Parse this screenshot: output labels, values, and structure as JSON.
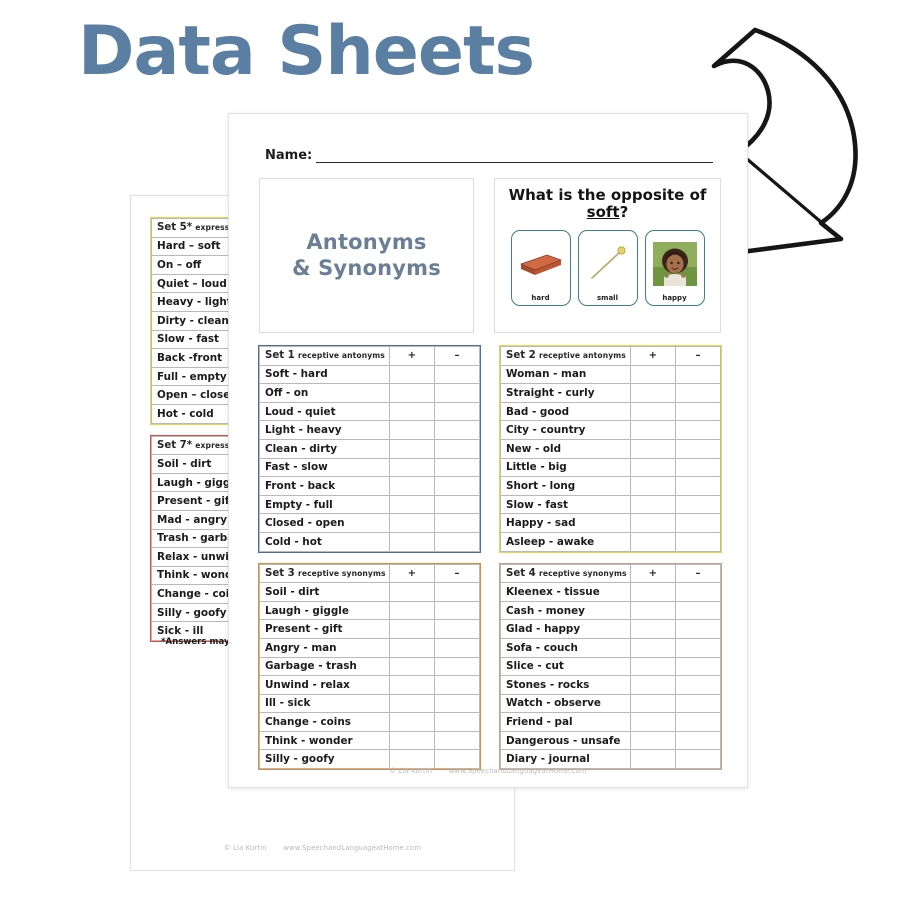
{
  "page": {
    "title": "Data Sheets",
    "title_color": "#5b7fa3",
    "arrow_icon": "curved-down-left-arrow"
  },
  "front_sheet": {
    "name_label": "Name:",
    "title_box": {
      "line1": "Antonyms",
      "line2": "& Synonyms"
    },
    "question_box": {
      "prompt_prefix": "What is the opposite of",
      "prompt_word": "soft",
      "prompt_suffix": "?",
      "cards": [
        {
          "label": "hard",
          "icon": "brick-image"
        },
        {
          "label": "small",
          "icon": "pin-needle-image"
        },
        {
          "label": "happy",
          "icon": "smiling-girl-photo"
        }
      ]
    },
    "mark_columns": {
      "plus": "+",
      "minus": "–"
    },
    "tables": [
      {
        "set_name": "Set 1",
        "set_sub": "receptive antonyms",
        "accent": "#4a6fa5",
        "accent_class": "blue",
        "rows": [
          "Soft - hard",
          "Off - on",
          "Loud - quiet",
          "Light - heavy",
          "Clean - dirty",
          "Fast - slow",
          "Front - back",
          "Empty - full",
          "Closed - open",
          "Cold - hot"
        ]
      },
      {
        "set_name": "Set 2",
        "set_sub": "receptive antonyms",
        "accent": "#efd64b",
        "accent_class": "yellow",
        "rows": [
          "Woman - man",
          "Straight - curly",
          "Bad - good",
          "City - country",
          "New - old",
          "Little - big",
          "Short - long",
          "Slow - fast",
          "Happy - sad",
          "Asleep - awake"
        ]
      },
      {
        "set_name": "Set 3",
        "set_sub": "receptive synonyms",
        "accent": "#e08a35",
        "accent_class": "orange",
        "rows": [
          "Soil - dirt",
          "Laugh - giggle",
          "Present - gift",
          "Angry - man",
          "Garbage - trash",
          "Unwind - relax",
          "Ill - sick",
          "Change - coins",
          "Think - wonder",
          "Silly - goofy"
        ]
      },
      {
        "set_name": "Set 4",
        "set_sub": "receptive synonyms",
        "accent": "#c6a088",
        "accent_class": "tan",
        "rows": [
          "Kleenex - tissue",
          "Cash - money",
          "Glad - happy",
          "Sofa - couch",
          "Slice - cut",
          "Stones - rocks",
          "Watch - observe",
          "Friend - pal",
          "Dangerous - unsafe",
          "Diary - journal"
        ]
      }
    ],
    "footer": {
      "copyright": "© Lia Kurtin",
      "website": "www.SpeechandLanguageatHome.com"
    }
  },
  "back_sheet": {
    "mark_columns": {
      "plus": "+",
      "minus": "–"
    },
    "tables": [
      {
        "set_name": "Set 5*",
        "set_sub": "expressive antonyms",
        "accent": "#efd64b",
        "accent_class": "yellow",
        "rows": [
          "Hard – soft",
          "On – off",
          "Quiet – loud",
          "Heavy - light",
          "Dirty - clean",
          "Slow - fast",
          "Back -front",
          "Full - empty",
          "Open – closed",
          "Hot - cold"
        ]
      },
      {
        "set_name": "Set 7*",
        "set_sub": "expressive synonyms",
        "accent": "#e24b3c",
        "accent_class": "red",
        "rows": [
          "Soil - dirt",
          "Laugh - giggle",
          "Present - gift",
          "Mad - angry",
          "Trash - garbage",
          "Relax - unwind",
          "Think - wonder",
          "Change - coins",
          "Silly - goofy",
          "Sick - ill"
        ]
      }
    ],
    "note": "*Answers may vary",
    "footer": {
      "copyright": "© Lia Kurtin",
      "website": "www.SpeechandLanguageatHome.com"
    }
  }
}
